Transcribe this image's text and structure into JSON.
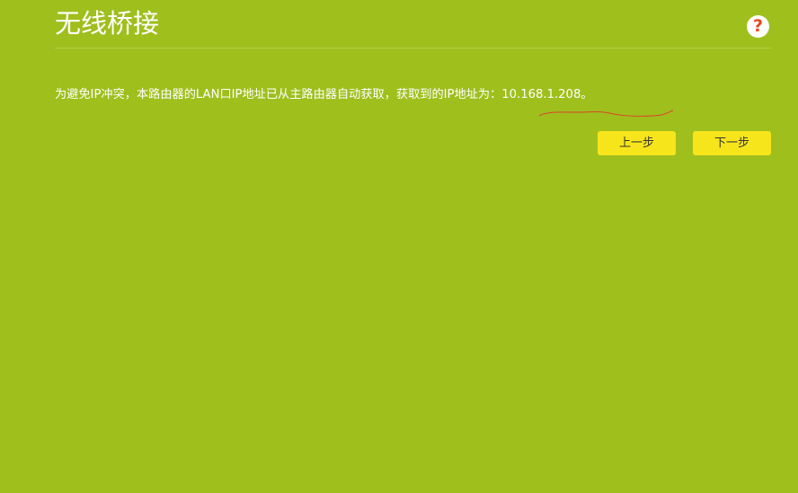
{
  "header": {
    "title": "无线桥接",
    "help_icon": "question-mark-icon",
    "help_glyph": "?"
  },
  "content": {
    "message_prefix": "为避免IP冲突，本路由器的LAN口IP地址已从主路由器自动获取，获取到的IP地址为：",
    "ip_address": "10.168.1.208",
    "message_suffix": "。"
  },
  "actions": {
    "prev_label": "上一步",
    "next_label": "下一步"
  },
  "colors": {
    "background": "#9fbf1d",
    "button": "#f7e51b",
    "help_icon": "#e8471d",
    "annotation": "#d9462a"
  }
}
